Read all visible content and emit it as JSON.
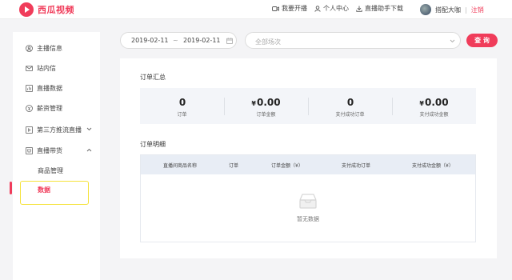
{
  "brand": {
    "name": "西瓜视频",
    "color": "#f03c5a"
  },
  "topnav": {
    "live": "我要开播",
    "profile": "个人中心",
    "download": "直播助手下载",
    "user": "搭配大咖",
    "logout": "注销"
  },
  "sidebar": {
    "items": [
      {
        "label": "主播信息",
        "icon": "user-circle-icon"
      },
      {
        "label": "站内信",
        "icon": "mail-icon"
      },
      {
        "label": "直播数据",
        "icon": "chart-icon"
      },
      {
        "label": "薪资管理",
        "icon": "money-icon"
      },
      {
        "label": "第三方推流直播",
        "icon": "stream-icon"
      },
      {
        "label": "直播带货",
        "icon": "cart-icon"
      }
    ],
    "sub_items": [
      {
        "label": "商品管理"
      },
      {
        "label": "数据"
      }
    ]
  },
  "filters": {
    "start_date": "2019-02-11",
    "separator": "~",
    "end_date": "2019-02-11",
    "session_placeholder": "全部场次",
    "query_label": "查 询"
  },
  "summary": {
    "title": "订单汇总",
    "cells": [
      {
        "value": "0",
        "currency": "",
        "label": "订单"
      },
      {
        "value": "0.00",
        "currency": "¥",
        "label": "订单金额"
      },
      {
        "value": "0",
        "currency": "",
        "label": "支付成功订单"
      },
      {
        "value": "0.00",
        "currency": "¥",
        "label": "支付成功金额"
      }
    ]
  },
  "detail": {
    "title": "订单明细",
    "columns": [
      "直播间商品名称",
      "订单",
      "订单金额（¥）",
      "支付成功订单",
      "支付成功金额（¥）"
    ],
    "empty_text": "暂无数据"
  }
}
